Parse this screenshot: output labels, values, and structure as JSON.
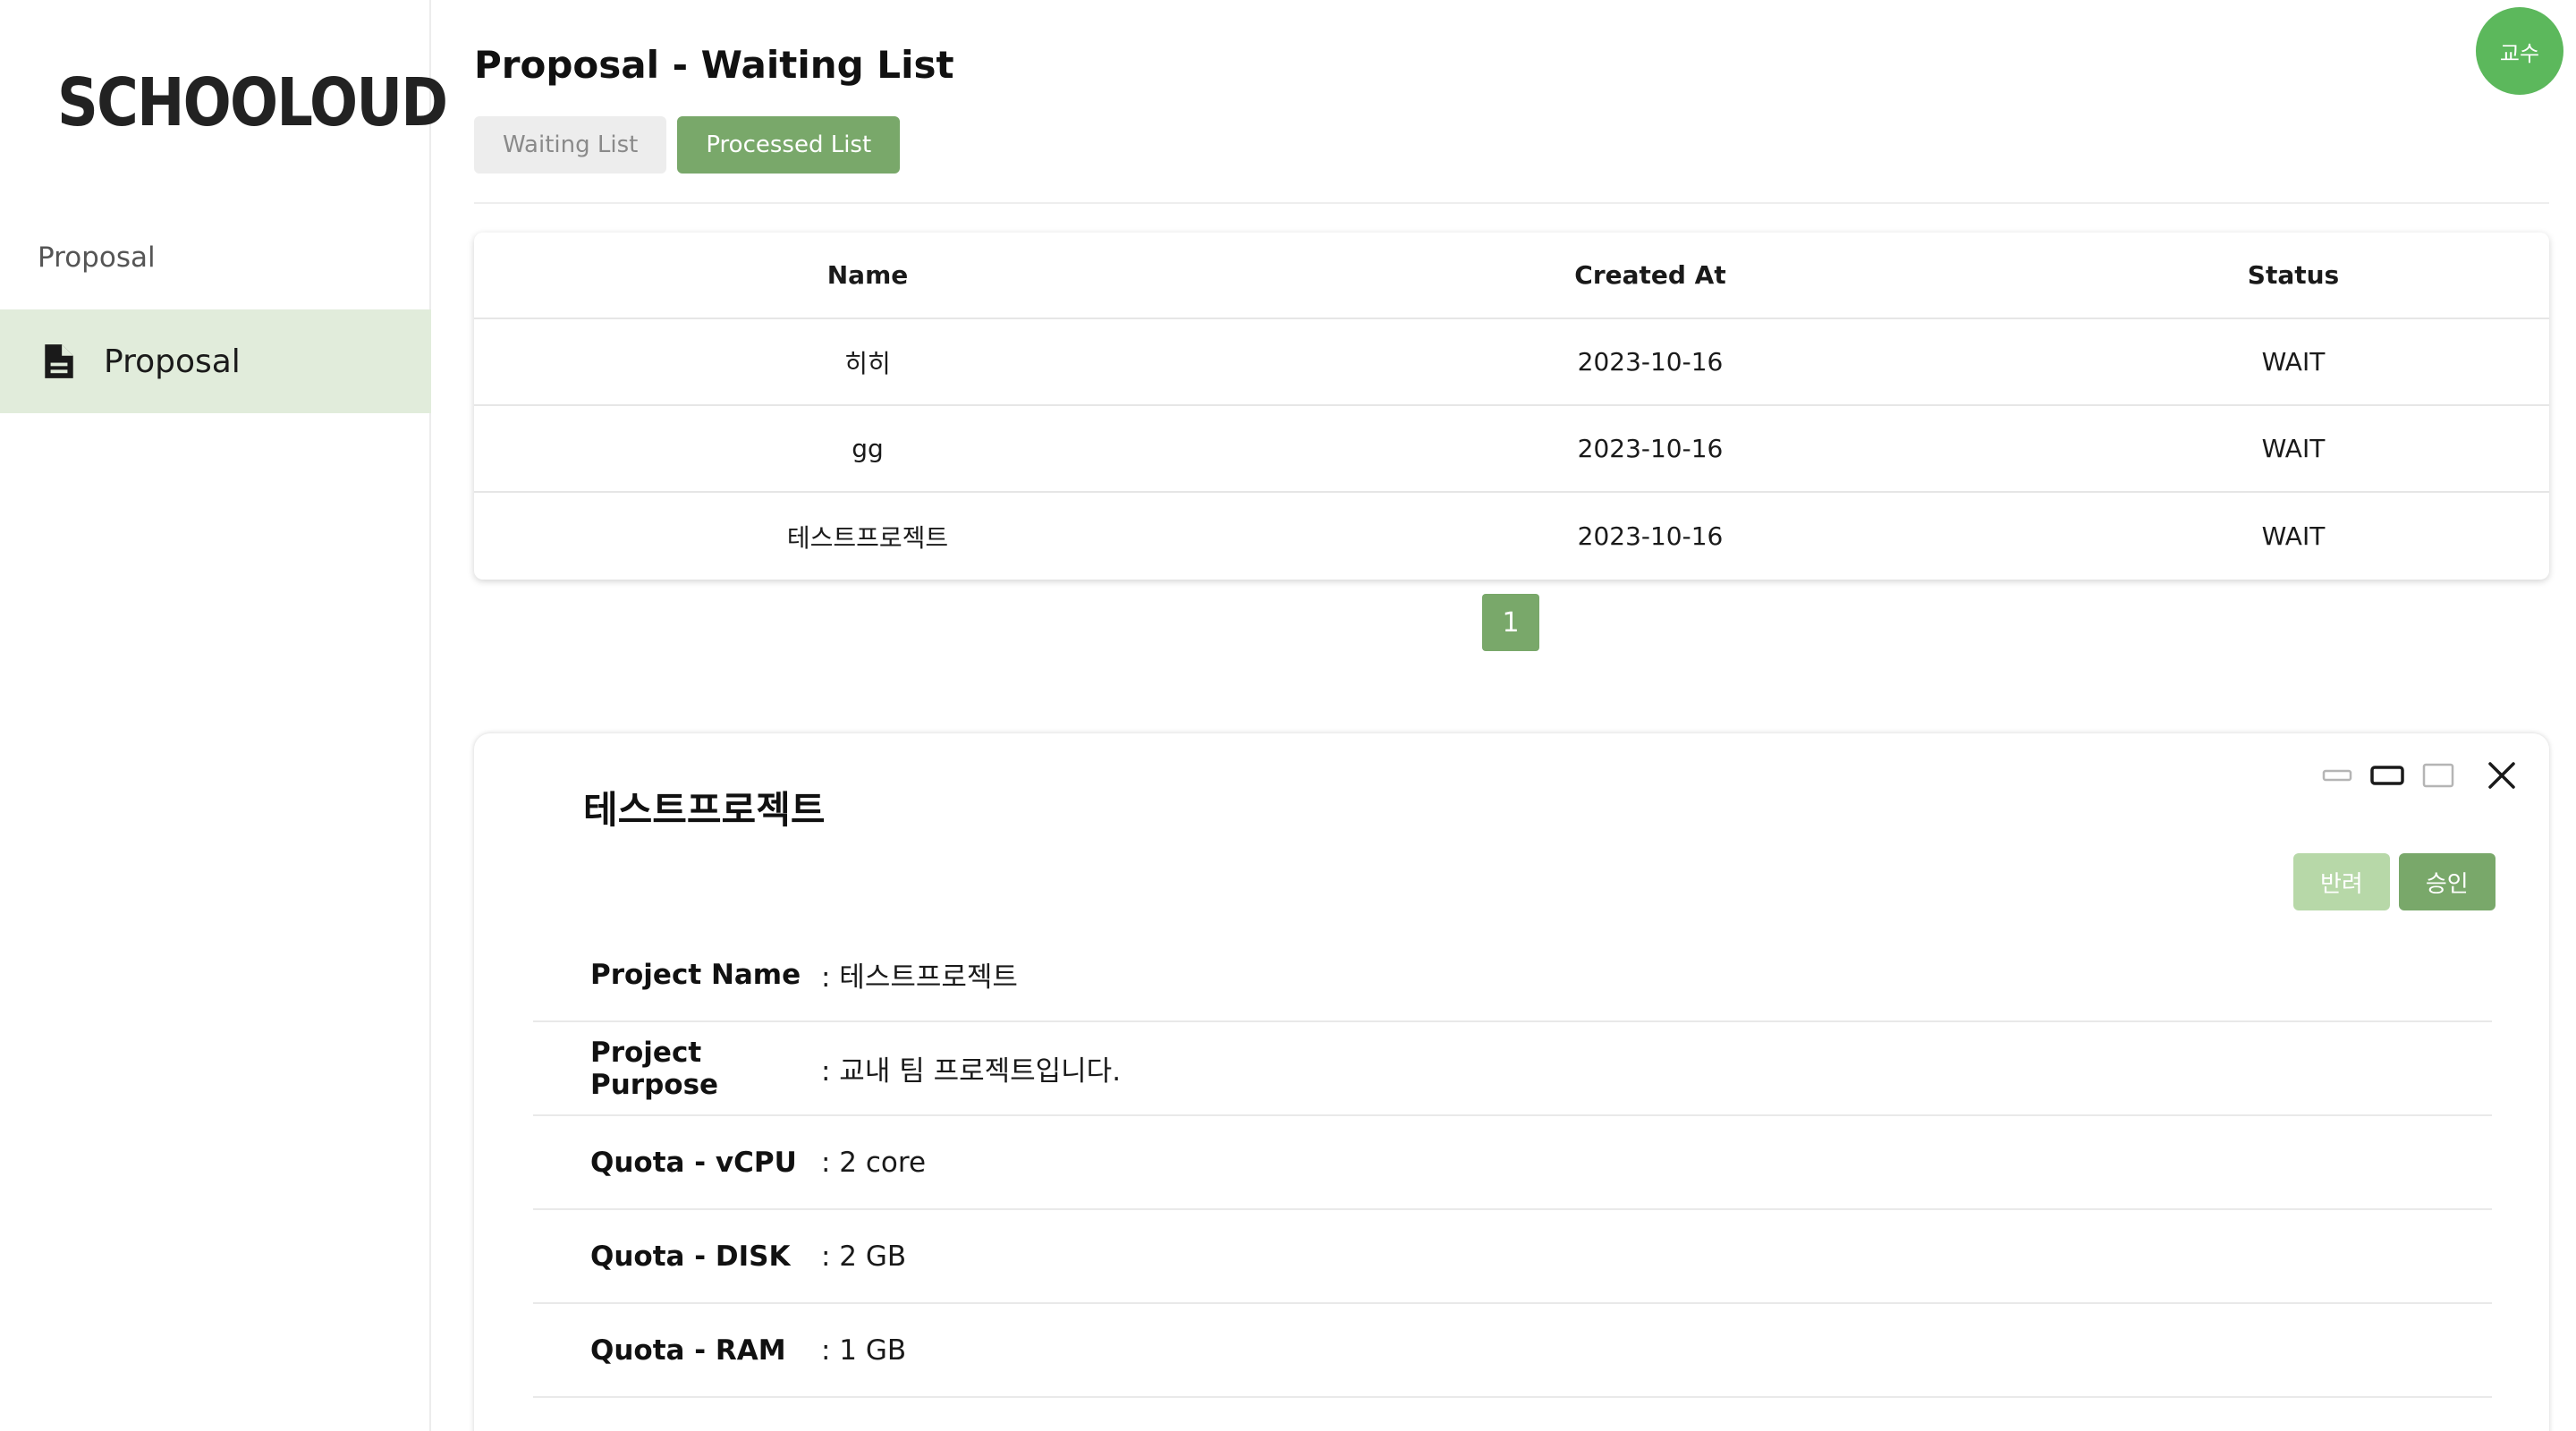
{
  "sidebar": {
    "logo": "SCHOOLOUD",
    "section_label": "Proposal",
    "items": [
      {
        "label": "Proposal",
        "icon": "document-icon"
      }
    ]
  },
  "user": {
    "avatar_label": "교수"
  },
  "header": {
    "title": "Proposal - Waiting List",
    "tabs": [
      {
        "label": "Waiting List"
      },
      {
        "label": "Processed List"
      }
    ]
  },
  "table": {
    "columns": [
      "Name",
      "Created At",
      "Status"
    ],
    "rows": [
      {
        "name": "히히",
        "created_at": "2023-10-16",
        "status": "WAIT"
      },
      {
        "name": "gg",
        "created_at": "2023-10-16",
        "status": "WAIT"
      },
      {
        "name": "테스트프로젝트",
        "created_at": "2023-10-16",
        "status": "WAIT"
      }
    ]
  },
  "pagination": {
    "current": "1"
  },
  "detail": {
    "title": "테스트프로젝트",
    "reject_label": "반려",
    "approve_label": "승인",
    "fields": [
      {
        "label": "Project Name",
        "value": ": 테스트프로젝트"
      },
      {
        "label": "Project Purpose",
        "value": ": 교내 팀 프로젝트입니다."
      },
      {
        "label": "Quota - vCPU",
        "value": ": 2 core"
      },
      {
        "label": "Quota - DISK",
        "value": ": 2 GB"
      },
      {
        "label": "Quota - RAM",
        "value": ": 1 GB"
      }
    ]
  },
  "colors": {
    "accent": "#79a86a",
    "accent_light": "#b7d8a8",
    "sidebar_active": "#e1ecdb",
    "avatar": "#5cb85c"
  }
}
